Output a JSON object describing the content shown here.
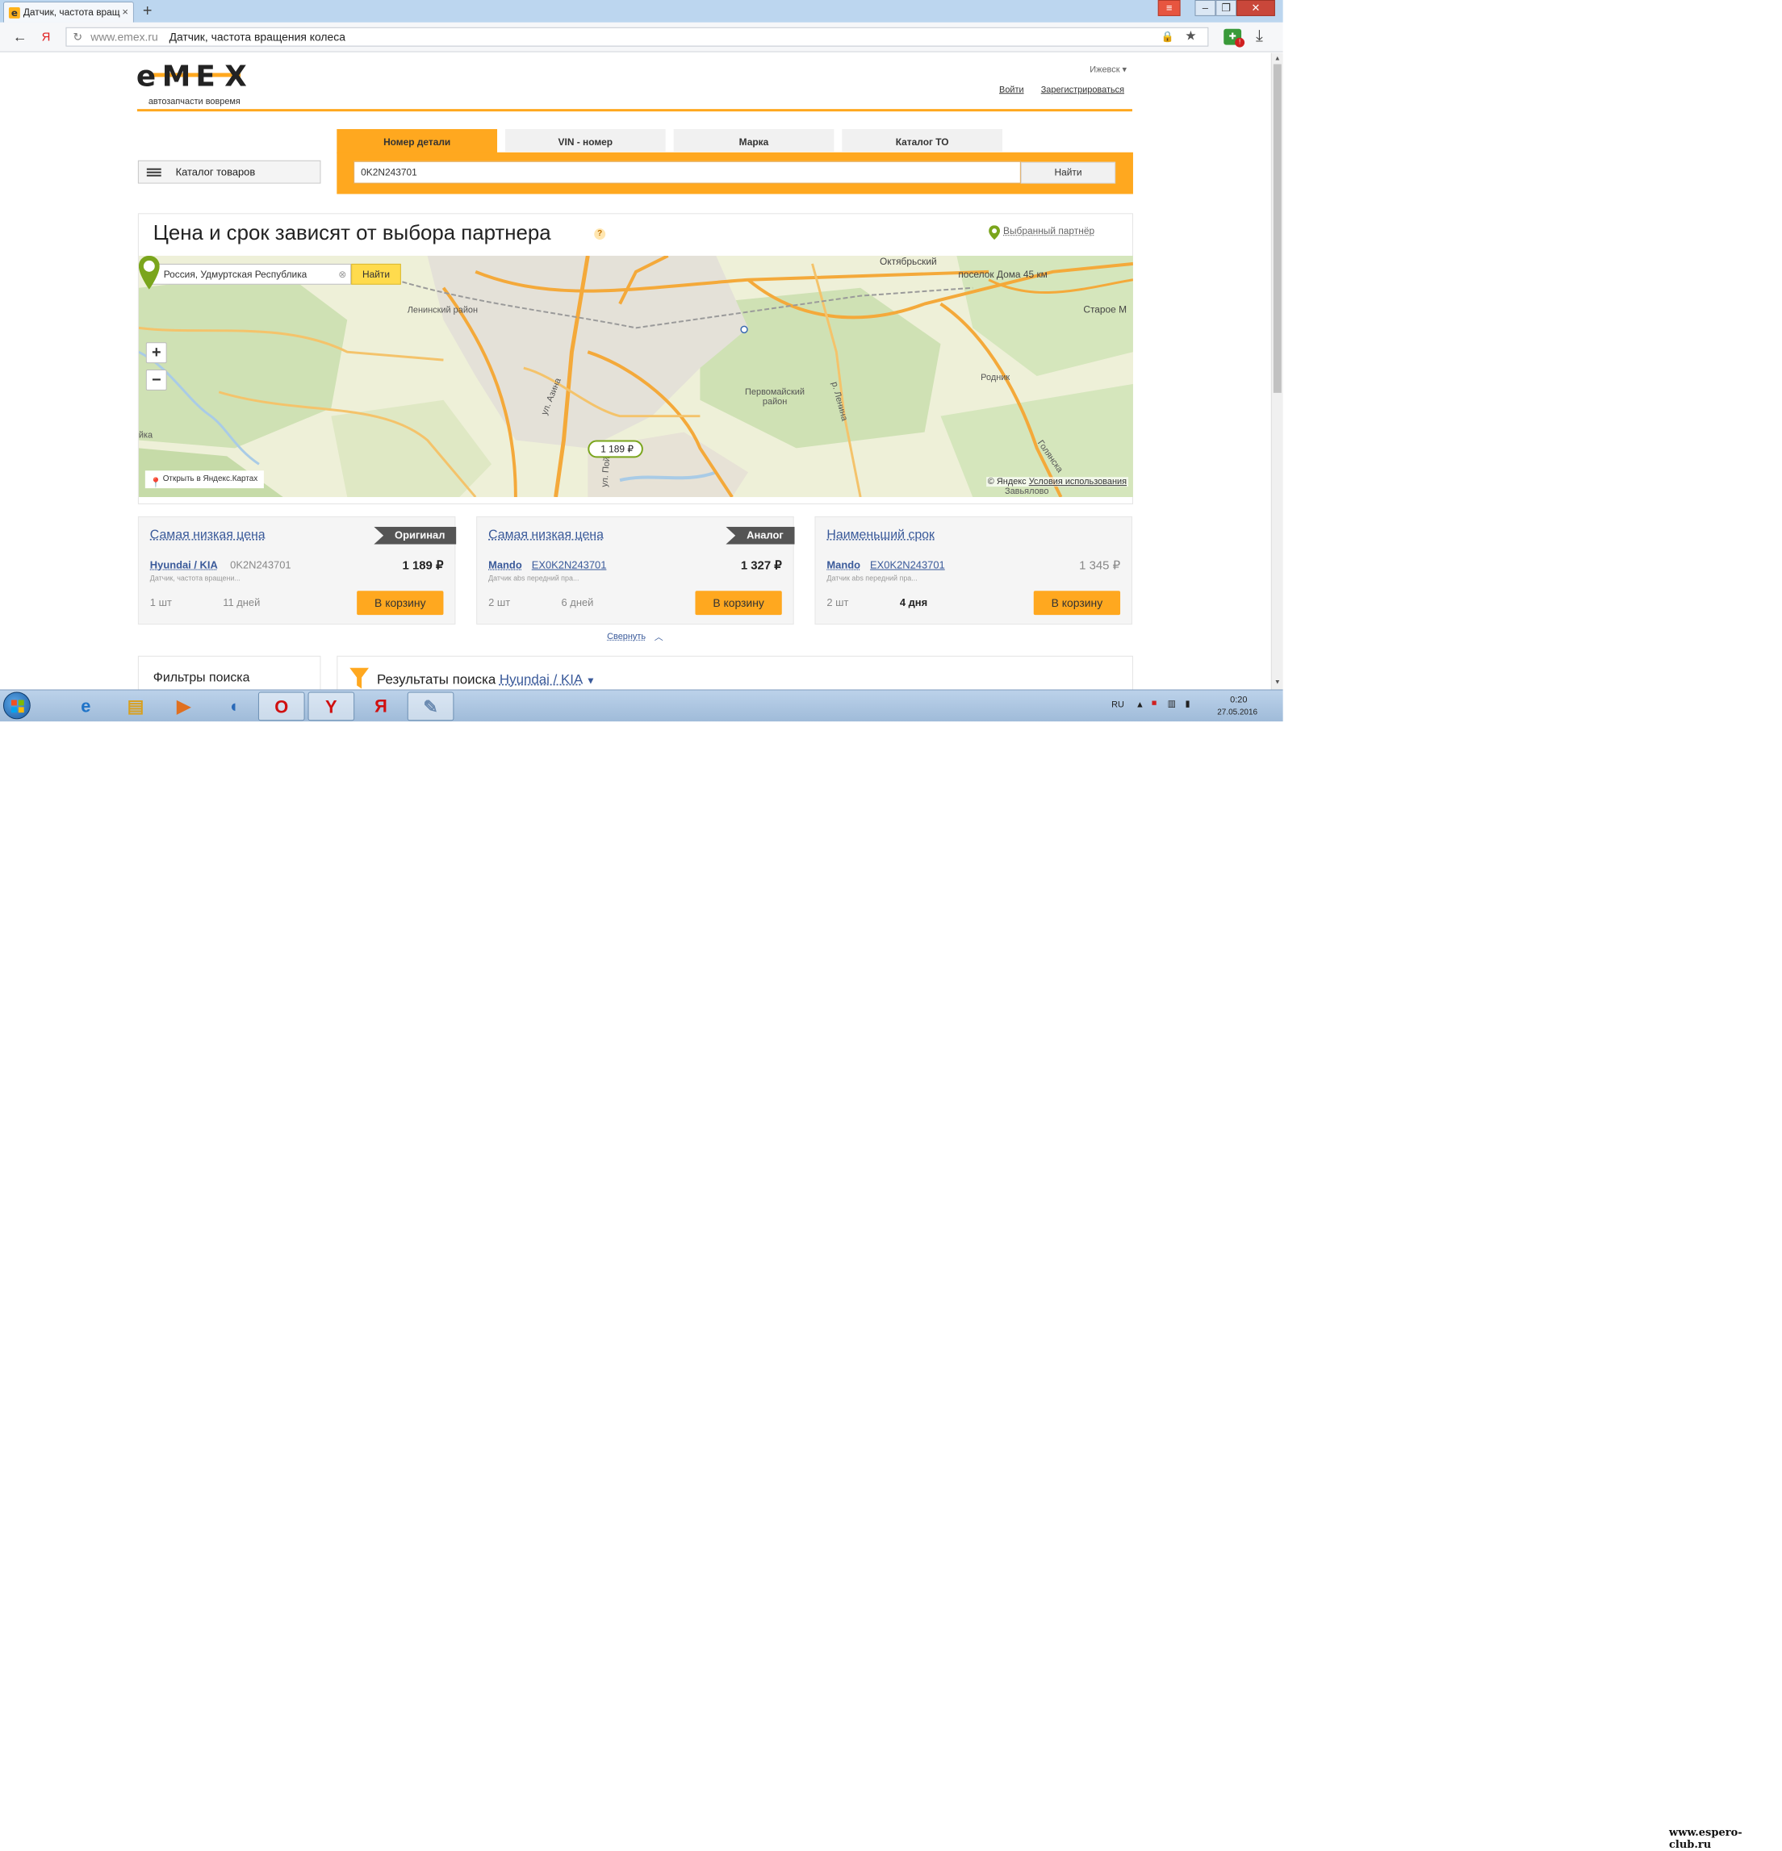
{
  "browser": {
    "tab_title": "Датчик, частота вращ",
    "tab_close": "×",
    "new_tab": "+",
    "url_domain": "www.emex.ru",
    "page_title": "Датчик, частота вращения колеса"
  },
  "header": {
    "logo_text": "e-m-e-x",
    "logo_sub": "автозапчасти вовремя",
    "city": "Ижевск",
    "login": "Войти",
    "register": "Зарегистрироваться"
  },
  "catalog_button": "Каталог товаров",
  "search": {
    "tabs": [
      "Номер детали",
      "VIN - номер",
      "Марка",
      "Каталог ТО"
    ],
    "active_tab": "Номер детали",
    "value": "0K2N243701",
    "button": "Найти"
  },
  "map_section": {
    "title": "Цена и срок зависят от выбора партнера",
    "help": "?",
    "partner_label": "Выбранный партнёр",
    "search_value": "Россия, Удмуртская Республика",
    "find_button": "Найти",
    "zoom_in": "+",
    "zoom_out": "−",
    "labels": {
      "oktyabrsky": "Октябрьский",
      "poselok": "поселок Дома 45 км",
      "staroe": "Старое М",
      "leninsky": "Ленинский район",
      "pervomaisky_1": "Первомайский",
      "pervomaisky_2": "район",
      "rodnik": "Родник",
      "azina": "ул. Азина",
      "lenina": "р. Ленина",
      "golyanskaya": "Голянска",
      "zavjalovo": "Завьялово",
      "yka": "йка",
      "pochta": "ул. Пойм"
    },
    "marker_price": "1 189 ₽",
    "open_in_yandex": "Открыть в Яндекс.Картах",
    "copyright": "© Яндекс",
    "terms": "Условия использования"
  },
  "offers": [
    {
      "title": "Самая низкая цена",
      "badge": "Оригинал",
      "brand": "Hyundai / KIA",
      "number": "0K2N243701",
      "price": "1 189 ₽",
      "desc": "Датчик, частота вращени...",
      "qty": "1 шт",
      "days": "11 дней",
      "cart": "В корзину"
    },
    {
      "title": "Самая низкая цена",
      "badge": "Аналог",
      "brand": "Mando",
      "number": "EX0K2N243701",
      "price": "1 327 ₽",
      "desc": "Датчик abs передний пра...",
      "qty": "2 шт",
      "days": "6 дней",
      "cart": "В корзину"
    },
    {
      "title": "Наименьший срок",
      "badge": "",
      "brand": "Mando",
      "number": "EX0K2N243701",
      "price": "1 345 ₽",
      "desc": "Датчик abs передний пра...",
      "qty": "2 шт",
      "days": "4 дня",
      "cart": "В корзину"
    }
  ],
  "collapse": "Свернуть",
  "filters_title": "Фильтры поиска",
  "results": {
    "label": "Результаты поиска",
    "brand": "Hyundai / KIA"
  },
  "taskbar": {
    "lang": "RU",
    "time": "0:20",
    "date": "27.05.2016"
  },
  "watermark": "www.espero-club.ru",
  "colors": {
    "accent": "#ffa81f",
    "link": "#3a5a9a",
    "map_pin": "#7aa51c"
  }
}
